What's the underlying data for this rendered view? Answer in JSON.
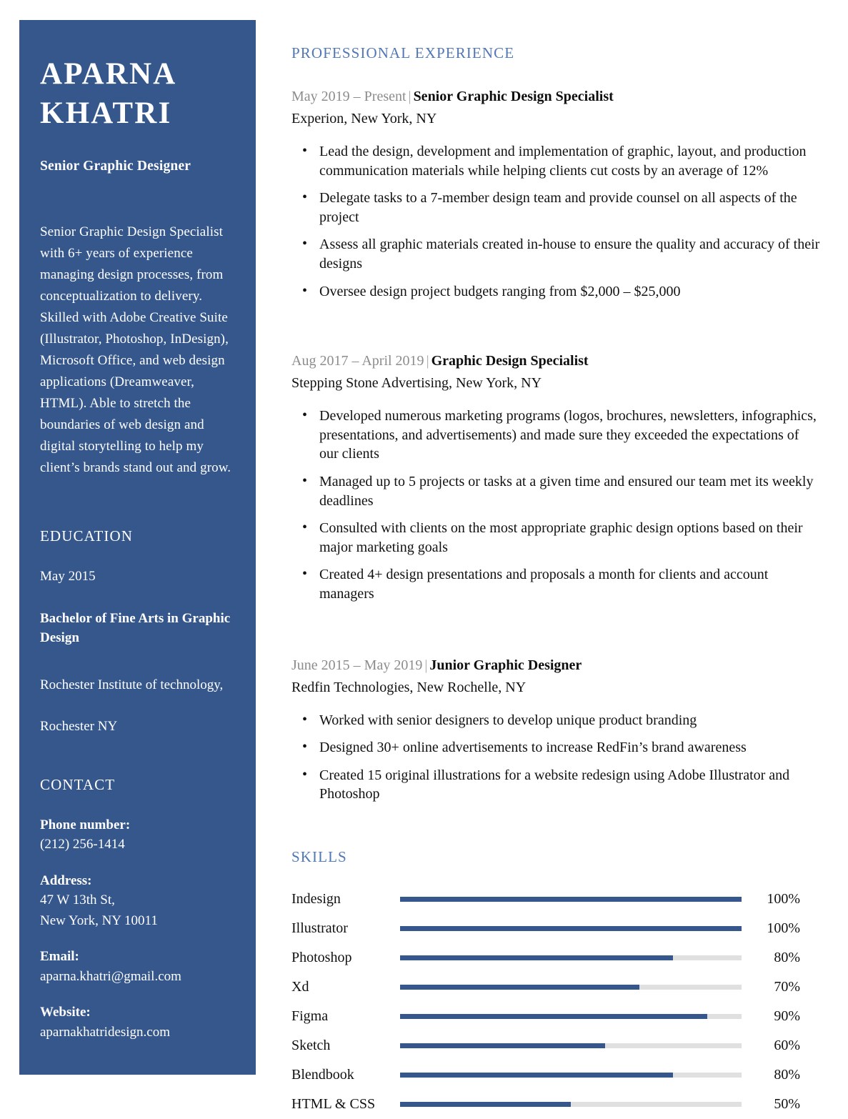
{
  "sidebar": {
    "name_lines": [
      "APARNA",
      "KHATRI"
    ],
    "job_title": "Senior Graphic Designer",
    "summary": "Senior Graphic Design Specialist with 6+ years of experience managing design processes, from conceptualization to delivery. Skilled with Adobe Creative Suite (Illustrator, Photoshop, InDesign), Microsoft Office, and web design applications (Dreamweaver, HTML). Able to stretch the boundaries of web design and digital storytelling to help my client’s brands stand out and grow.",
    "education": {
      "heading": "EDUCATION",
      "date": "May 2015",
      "degree": "Bachelor of Fine Arts in Graphic Design",
      "school": "Rochester Institute of technology,",
      "location": "Rochester NY"
    },
    "contact": {
      "heading": "CONTACT",
      "phone_label": "Phone number:",
      "phone_value": "(212) 256-1414",
      "address_label": "Address:",
      "address_line1": "47 W 13th St,",
      "address_line2": "New York, NY 10011",
      "email_label": "Email:",
      "email_value": "aparna.khatri@gmail.com",
      "website_label": "Website:",
      "website_value": "aparnakhatridesign.com"
    }
  },
  "experience": {
    "heading": "PROFESSIONAL EXPERIENCE",
    "jobs": [
      {
        "dates": "May 2019 – Present",
        "separator": "|",
        "title": "Senior Graphic Design Specialist",
        "company": "Experion, New York, NY",
        "bullets": [
          "Lead the design, development and implementation of graphic, layout, and production communication materials while helping clients cut costs by an average of 12%",
          "Delegate tasks to a 7-member design team and provide counsel on all aspects of the project",
          "Assess all graphic materials created in-house to ensure the quality and accuracy of their designs",
          "Oversee design project budgets ranging from $2,000 – $25,000"
        ]
      },
      {
        "dates": "Aug 2017 – April 2019",
        "separator": "|",
        "title": "Graphic Design Specialist",
        "company": "Stepping Stone Advertising, New York, NY",
        "bullets": [
          "Developed numerous marketing programs (logos, brochures, newsletters, infographics, presentations, and advertisements) and made sure they exceeded the expectations of our clients",
          "Managed up to 5 projects or tasks at a given time and ensured our team met its weekly deadlines",
          "Consulted with clients on the most appropriate graphic design options based on their major marketing goals",
          "Created 4+ design presentations and proposals a month for clients and account managers"
        ]
      },
      {
        "dates": "June 2015 – May 2019",
        "separator": "|",
        "title": "Junior Graphic Designer",
        "company": "Redfin Technologies, New Rochelle, NY",
        "bullets": [
          "Worked with senior designers to develop unique product branding",
          "Designed 30+ online advertisements to increase RedFin’s brand awareness",
          "Created 15 original illustrations for a website redesign using Adobe Illustrator and Photoshop"
        ]
      }
    ]
  },
  "skills": {
    "heading": "SKILLS",
    "items": [
      {
        "name": "Indesign",
        "percent_label": "100%",
        "percent": 100
      },
      {
        "name": "Illustrator",
        "percent_label": "100%",
        "percent": 100
      },
      {
        "name": "Photoshop",
        "percent_label": "80%",
        "percent": 80
      },
      {
        "name": "Xd",
        "percent_label": "70%",
        "percent": 70
      },
      {
        "name": "Figma",
        "percent_label": "90%",
        "percent": 90
      },
      {
        "name": "Sketch",
        "percent_label": "60%",
        "percent": 60
      },
      {
        "name": "Blendbook",
        "percent_label": "80%",
        "percent": 80
      },
      {
        "name": "HTML & CSS",
        "percent_label": "50%",
        "percent": 50
      }
    ]
  },
  "colors": {
    "sidebar_blue": "#35578c",
    "heading_blue": "#5178b5",
    "bar_fill": "#35578c",
    "bar_track": "#e0e0e0",
    "date_gray": "#8c8c8c"
  }
}
